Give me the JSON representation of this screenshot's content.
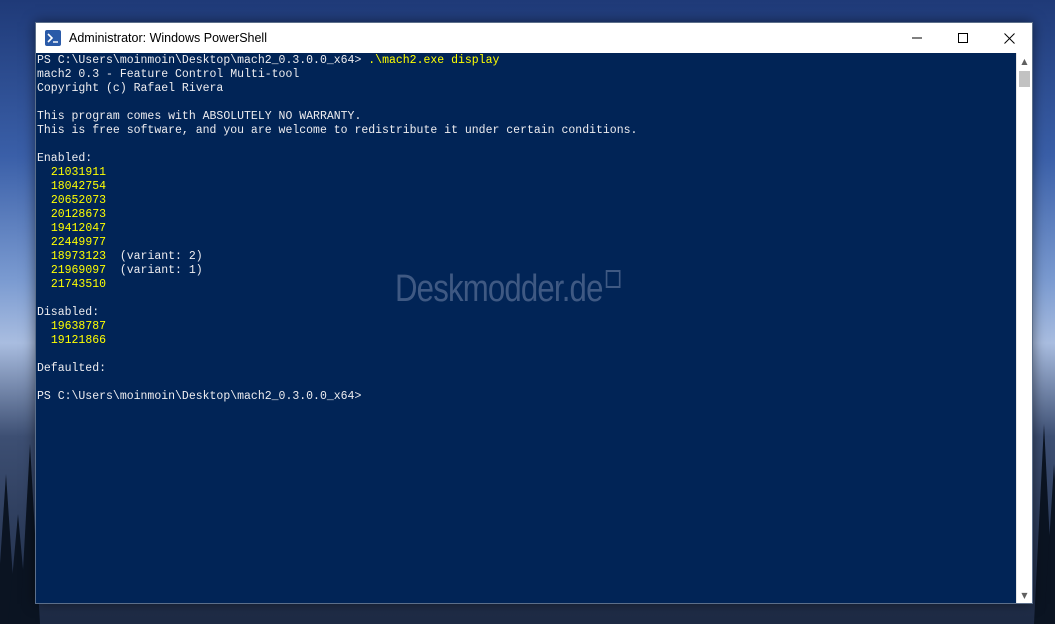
{
  "window": {
    "title": "Administrator: Windows PowerShell",
    "icons": {
      "app": "powershell-icon",
      "minimize": "minimize-icon",
      "maximize": "maximize-icon",
      "close": "close-icon"
    }
  },
  "console": {
    "prompt_path": "PS C:\\Users\\moinmoin\\Desktop\\mach2_0.3.0.0_x64> ",
    "command": ".\\mach2.exe display",
    "header_lines": [
      "mach2 0.3 - Feature Control Multi-tool",
      "Copyright (c) Rafael Rivera",
      "",
      "This program comes with ABSOLUTELY NO WARRANTY.",
      "This is free software, and you are welcome to redistribute it under certain conditions.",
      ""
    ],
    "enabled_label": "Enabled:",
    "enabled": [
      {
        "id": "21031911",
        "note": ""
      },
      {
        "id": "18042754",
        "note": ""
      },
      {
        "id": "20652073",
        "note": ""
      },
      {
        "id": "20128673",
        "note": ""
      },
      {
        "id": "19412047",
        "note": ""
      },
      {
        "id": "22449977",
        "note": ""
      },
      {
        "id": "18973123",
        "note": "  (variant: 2)"
      },
      {
        "id": "21969097",
        "note": "  (variant: 1)"
      },
      {
        "id": "21743510",
        "note": ""
      }
    ],
    "disabled_label": "Disabled:",
    "disabled": [
      {
        "id": "19638787"
      },
      {
        "id": "19121866"
      }
    ],
    "defaulted_label": "Defaulted:",
    "final_prompt": "PS C:\\Users\\moinmoin\\Desktop\\mach2_0.3.0.0_x64>"
  },
  "watermark": {
    "text": "Deskmodder.de"
  },
  "colors": {
    "console_bg": "#012456",
    "console_text": "#eeedf0",
    "highlight": "#ffff00"
  }
}
